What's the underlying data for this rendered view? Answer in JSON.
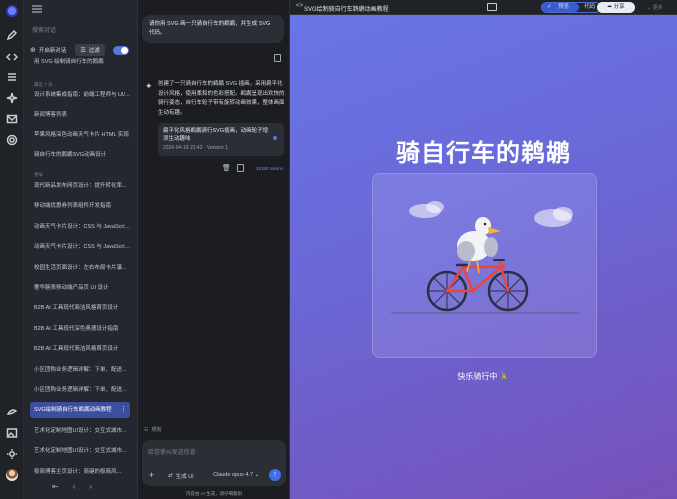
{
  "sidebar": {
    "search_placeholder": "搜索对话",
    "new_chat": "开启新对话",
    "filter_label": "过滤",
    "pinned_item": "用 SVG 绘制骑自行车的鹅鹕",
    "section_recent": "最近 7 天",
    "section_earlier": "更早",
    "items": [
      "设计系统集成指南：前端工程师与 UI/...",
      "新闻博客列表",
      "苹果风格深色动画天气卡片 HTML 实现",
      "骑自行车的鹅鹕SVG动画设计",
      "现代新品发布网页设计：提升转化率...",
      "移动端优惠券列表组件开发指南",
      "动画天气卡片设计：CSS 与 JavaScrip...",
      "动画天气卡片设计：CSS 与 JavaScrip...",
      "校园生活页面设计：左右布局卡片瀑...",
      "奢华腕表移动端产品页 UI 设计",
      "B2B AI 工具现代简洁风格首页设计",
      "B2B AI 工具现代深色奥德设计指南",
      "B2B AI 工具现代简洁风格首页设计",
      "小区团购业务逻辑详解：下单、配送...",
      "小区团购业务逻辑详解：下单、配送...",
      "SVG绘制骑自行车鹈鹕动画教程",
      "艺术化定制地图UI设计：交互式城市...",
      "艺术化定制地图UI设计：交互式城市...",
      "极简博客主页设计：简键的极简风..."
    ],
    "active_index": 15
  },
  "chat": {
    "user_message": "请你用 SVG 画一只骑自行车的鹈鹕，并生成 SVG 代码。",
    "ai_message": "创建了一只骑自行车的鹈鹕 SVG 插画，采用扁平化设计风格，使用柔和的色彩搭配。鹈鹕呈现出欢快的骑行姿态，自行车轮子带有旋转动画效果，整体画面生动有趣。",
    "artifact_title": "扁平化风格鹈鹕骑行SVG插画，动画轮子增添生动趣味",
    "artifact_meta": "2026-04-19 21:42 · Version 1",
    "tokens": "18180 tokens",
    "plan_tag": "规划",
    "composer_placeholder": "给信使AI发送信息",
    "generate_ui": "生成 UI",
    "model": "Claude opus 4.7",
    "footer": "内容由 AI 生成，请仔细甄别"
  },
  "preview": {
    "title": "SVG绘制骑自行车鹈鹕动画教程",
    "tab_preview": "预览",
    "tab_code": "代码",
    "share": "分享",
    "more": "更多",
    "heading": "骑自行车的鹈鹕",
    "caption": "快乐骑行中 🚴"
  },
  "colors": {
    "accent": "#3b5ccc",
    "gradient_start": "#6975e6",
    "gradient_end": "#7651b8",
    "bike_frame": "#e8453c"
  }
}
